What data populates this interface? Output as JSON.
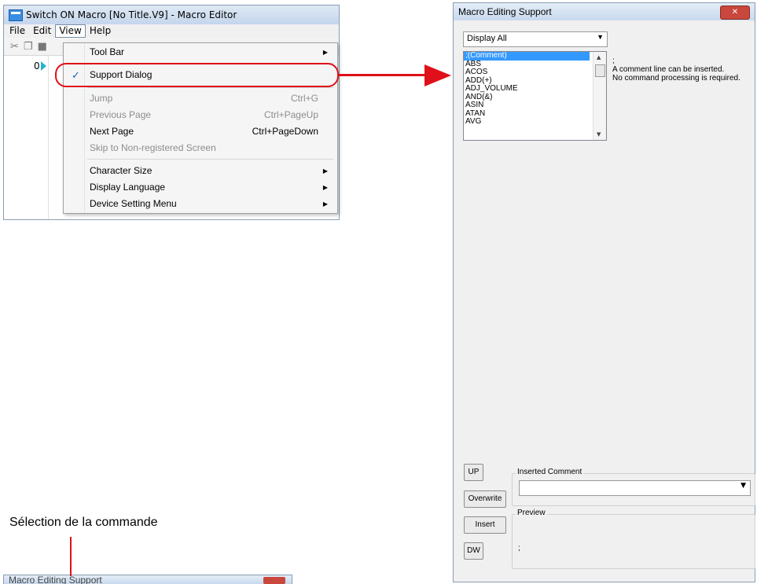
{
  "editor": {
    "title": "Switch ON Macro [No Title.V9] - Macro Editor",
    "menus": [
      "File",
      "Edit",
      "View",
      "Help"
    ],
    "line_number": "0"
  },
  "view_menu": {
    "items": [
      {
        "label": "Tool Bar",
        "shortcut": "",
        "submenu": true,
        "disabled": false,
        "checked": false
      },
      {
        "label": "Support Dialog",
        "shortcut": "",
        "submenu": false,
        "disabled": false,
        "checked": true
      },
      {
        "label": "Jump",
        "shortcut": "Ctrl+G",
        "submenu": false,
        "disabled": true,
        "checked": false
      },
      {
        "label": "Previous Page",
        "shortcut": "Ctrl+PageUp",
        "submenu": false,
        "disabled": true,
        "checked": false
      },
      {
        "label": "Next Page",
        "shortcut": "Ctrl+PageDown",
        "submenu": false,
        "disabled": false,
        "checked": false
      },
      {
        "label": "Skip to Non-registered Screen",
        "shortcut": "",
        "submenu": false,
        "disabled": true,
        "checked": false
      },
      {
        "label": "Character Size",
        "shortcut": "",
        "submenu": true,
        "disabled": false,
        "checked": false
      },
      {
        "label": "Display Language",
        "shortcut": "",
        "submenu": true,
        "disabled": false,
        "checked": false
      },
      {
        "label": "Device Setting Menu",
        "shortcut": "",
        "submenu": true,
        "disabled": false,
        "checked": false
      }
    ]
  },
  "support": {
    "title": "Macro Editing Support",
    "filter": "Display All",
    "commands": [
      ";(Comment)",
      "ABS",
      "ACOS",
      "ADD(+)",
      "ADJ_VOLUME",
      "AND(&)",
      "ASIN",
      "ATAN",
      "AVG"
    ],
    "selected_command": ";(Comment)",
    "description": [
      ";",
      "A comment line can be inserted.",
      "No command processing is required."
    ],
    "buttons": {
      "up": "UP",
      "overwrite": "Overwrite",
      "insert": "Insert",
      "dw": "DW"
    },
    "inserted_comment_label": "Inserted Comment",
    "inserted_comment_value": "",
    "preview_label": "Preview",
    "preview_text": ";"
  },
  "caption": "Sélection de la commande",
  "mini_window_title": "Macro Editing Support",
  "colors": {
    "accent_red": "#e0101a",
    "selection_blue": "#3399ff"
  }
}
